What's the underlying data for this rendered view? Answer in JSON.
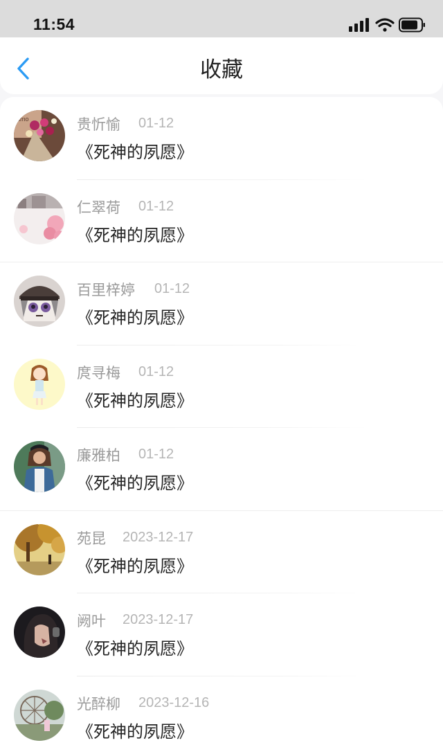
{
  "status_bar": {
    "time": "11:54",
    "icons": [
      "signal-icon",
      "wifi-icon",
      "battery-icon"
    ]
  },
  "nav": {
    "title": "收藏",
    "back_icon": "chevron-left-icon",
    "accent_color": "#2b9bf4"
  },
  "favorites": [
    {
      "name": "贵忻愉",
      "date": "01-12",
      "title": "《死神的夙愿》",
      "avatar": "bouquet"
    },
    {
      "name": "仁翠荷",
      "date": "01-12",
      "title": "《死神的夙愿》",
      "avatar": "blossom"
    },
    {
      "name": "百里梓婷",
      "date": "01-12",
      "title": "《死神的夙愿》",
      "avatar": "anime-cap"
    },
    {
      "name": "庹寻梅",
      "date": "01-12",
      "title": "《死神的夙愿》",
      "avatar": "cartoon-girl"
    },
    {
      "name": "廉雅柏",
      "date": "01-12",
      "title": "《死神的夙愿》",
      "avatar": "girl-denim"
    },
    {
      "name": "苑昆",
      "date": "2023-12-17",
      "title": "《死神的夙愿》",
      "avatar": "autumn-tree"
    },
    {
      "name": "阙叶",
      "date": "2023-12-17",
      "title": "《死神的夙愿》",
      "avatar": "dark-portrait"
    },
    {
      "name": "光醉柳",
      "date": "2023-12-16",
      "title": "《死神的夙愿》",
      "avatar": "park-wheel"
    }
  ]
}
